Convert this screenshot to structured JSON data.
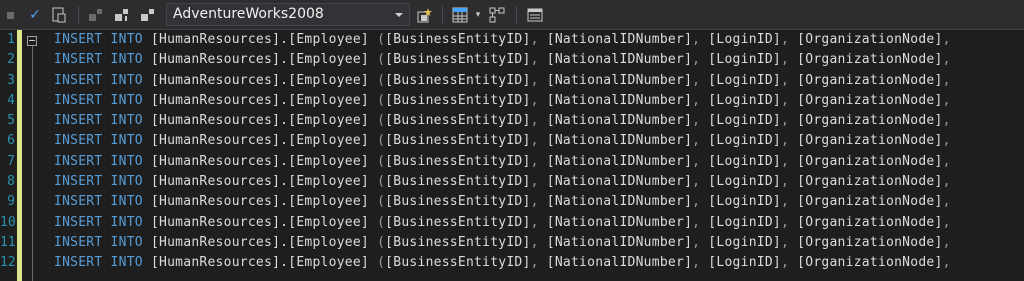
{
  "toolbar": {
    "icons": [
      "stop-icon",
      "check-icon",
      "parse-icon",
      "disconnect-icon",
      "change-connection-icon",
      "connection-icon",
      "new-query-star-icon",
      "grid-results-icon",
      "dropdown-arrow-icon",
      "query-plan-icon",
      "results-pane-icon"
    ],
    "database": "AdventureWorks2008"
  },
  "editor": {
    "colors": {
      "keyword": "#569cd6",
      "identifier": "#dcdcdc",
      "punct": "#9b9b9b",
      "line_number": "#2b91af",
      "change_bar": "#dbe58c"
    },
    "line_numbers": [
      "1",
      "2",
      "3",
      "4",
      "5",
      "6",
      "7",
      "8",
      "9",
      "10",
      "11",
      "12"
    ],
    "keyword1": "INSERT",
    "keyword2": "INTO",
    "table": "[HumanResources].[Employee]",
    "columns": "([BusinessEntityID], [NationalIDNumber], [LoginID], [OrganizationNode],"
  }
}
